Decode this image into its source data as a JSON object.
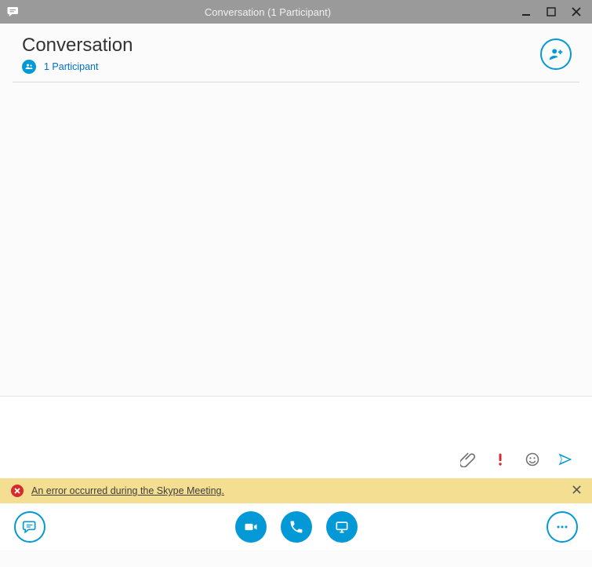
{
  "window": {
    "title": "Conversation (1 Participant)"
  },
  "header": {
    "title": "Conversation",
    "participant_count": "1 Participant"
  },
  "error": {
    "message": "An error occurred during the Skype Meeting."
  },
  "icons": {
    "app": "chat-bubble",
    "add_person": "person-plus",
    "attach": "paperclip",
    "important": "exclamation",
    "emoji": "smiley",
    "send": "paper-plane",
    "chat": "chat-bubble",
    "video": "video-camera",
    "call": "phone",
    "present": "monitor",
    "more": "ellipsis"
  },
  "colors": {
    "accent": "#0398D6",
    "titlebar": "#9A9A9A",
    "error_bg": "#F4DE91",
    "error_icon": "#D62B2B",
    "important": "#D62B2B",
    "icon_gray": "#707070"
  }
}
